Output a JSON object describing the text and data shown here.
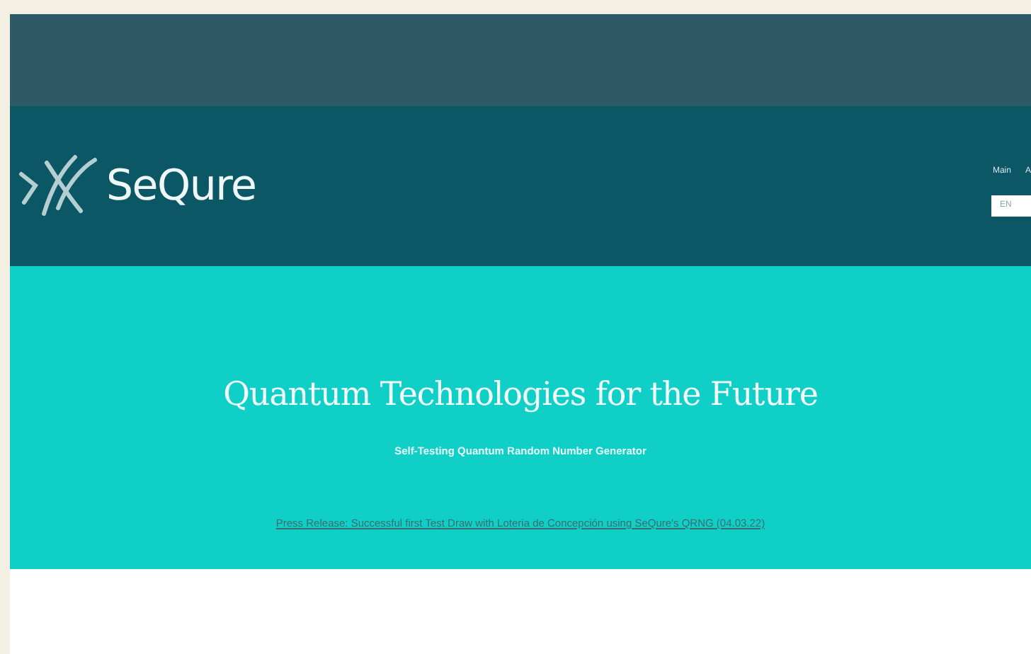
{
  "logo": {
    "text": "SeQure"
  },
  "nav": [
    {
      "label": "Main"
    },
    {
      "label": "A"
    }
  ],
  "language": {
    "label": "EN"
  },
  "hero": {
    "title": "Quantum Technologies for the Future",
    "subtitle": "Self-Testing  Quantum Random Number Generator",
    "link": "Press Release: Successful first Test Draw with Loteria de Concepción using SeQure's QRNG  (04.03.22)"
  }
}
